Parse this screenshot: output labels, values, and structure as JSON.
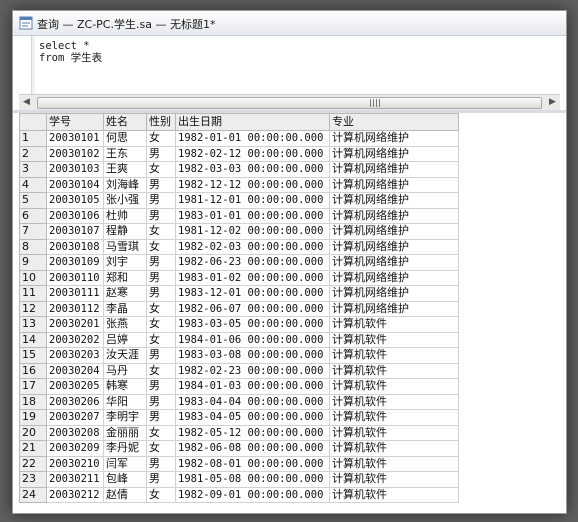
{
  "window": {
    "title": "查询 — ZC-PC.学生.sa — 无标题1*"
  },
  "editor": {
    "lines": [
      "select *",
      "from 学生表"
    ]
  },
  "grid": {
    "columns": [
      "学号",
      "姓名",
      "性别",
      "出生日期",
      "专业"
    ],
    "rows": [
      {
        "n": "1",
        "id": "20030101",
        "name": "何思",
        "sex": "女",
        "dob": "1982-01-01 00:00:00.000",
        "major": "计算机网络维护"
      },
      {
        "n": "2",
        "id": "20030102",
        "name": "王东",
        "sex": "男",
        "dob": "1982-02-12 00:00:00.000",
        "major": "计算机网络维护"
      },
      {
        "n": "3",
        "id": "20030103",
        "name": "王爽",
        "sex": "女",
        "dob": "1982-03-03 00:00:00.000",
        "major": "计算机网络维护"
      },
      {
        "n": "4",
        "id": "20030104",
        "name": "刘海峰",
        "sex": "男",
        "dob": "1982-12-12 00:00:00.000",
        "major": "计算机网络维护"
      },
      {
        "n": "5",
        "id": "20030105",
        "name": "张小强",
        "sex": "男",
        "dob": "1981-12-01 00:00:00.000",
        "major": "计算机网络维护"
      },
      {
        "n": "6",
        "id": "20030106",
        "name": "杜帅",
        "sex": "男",
        "dob": "1983-01-01 00:00:00.000",
        "major": "计算机网络维护"
      },
      {
        "n": "7",
        "id": "20030107",
        "name": "程静",
        "sex": "女",
        "dob": "1981-12-02 00:00:00.000",
        "major": "计算机网络维护"
      },
      {
        "n": "8",
        "id": "20030108",
        "name": "马雪琪",
        "sex": "女",
        "dob": "1982-02-03 00:00:00.000",
        "major": "计算机网络维护"
      },
      {
        "n": "9",
        "id": "20030109",
        "name": "刘宇",
        "sex": "男",
        "dob": "1982-06-23 00:00:00.000",
        "major": "计算机网络维护"
      },
      {
        "n": "10",
        "id": "20030110",
        "name": "郑和",
        "sex": "男",
        "dob": "1983-01-02 00:00:00.000",
        "major": "计算机网络维护"
      },
      {
        "n": "11",
        "id": "20030111",
        "name": "赵寒",
        "sex": "男",
        "dob": "1983-12-01 00:00:00.000",
        "major": "计算机网络维护"
      },
      {
        "n": "12",
        "id": "20030112",
        "name": "李晶",
        "sex": "女",
        "dob": "1982-06-07 00:00:00.000",
        "major": "计算机网络维护"
      },
      {
        "n": "13",
        "id": "20030201",
        "name": "张燕",
        "sex": "女",
        "dob": "1983-03-05 00:00:00.000",
        "major": "计算机软件"
      },
      {
        "n": "14",
        "id": "20030202",
        "name": "吕婷",
        "sex": "女",
        "dob": "1984-01-06 00:00:00.000",
        "major": "计算机软件"
      },
      {
        "n": "15",
        "id": "20030203",
        "name": "汝天涯",
        "sex": "男",
        "dob": "1983-03-08 00:00:00.000",
        "major": "计算机软件"
      },
      {
        "n": "16",
        "id": "20030204",
        "name": "马丹",
        "sex": "女",
        "dob": "1982-02-23 00:00:00.000",
        "major": "计算机软件"
      },
      {
        "n": "17",
        "id": "20030205",
        "name": "韩寒",
        "sex": "男",
        "dob": "1984-01-03 00:00:00.000",
        "major": "计算机软件"
      },
      {
        "n": "18",
        "id": "20030206",
        "name": "华阳",
        "sex": "男",
        "dob": "1983-04-04 00:00:00.000",
        "major": "计算机软件"
      },
      {
        "n": "19",
        "id": "20030207",
        "name": "李明宇",
        "sex": "男",
        "dob": "1983-04-05 00:00:00.000",
        "major": "计算机软件"
      },
      {
        "n": "20",
        "id": "20030208",
        "name": "金丽丽",
        "sex": "女",
        "dob": "1982-05-12 00:00:00.000",
        "major": "计算机软件"
      },
      {
        "n": "21",
        "id": "20030209",
        "name": "李丹妮",
        "sex": "女",
        "dob": "1982-06-08 00:00:00.000",
        "major": "计算机软件"
      },
      {
        "n": "22",
        "id": "20030210",
        "name": "闫军",
        "sex": "男",
        "dob": "1982-08-01 00:00:00.000",
        "major": "计算机软件"
      },
      {
        "n": "23",
        "id": "20030211",
        "name": "包峰",
        "sex": "男",
        "dob": "1981-05-08 00:00:00.000",
        "major": "计算机软件"
      },
      {
        "n": "24",
        "id": "20030212",
        "name": "赵倩",
        "sex": "女",
        "dob": "1982-09-01 00:00:00.000",
        "major": "计算机软件"
      }
    ]
  }
}
